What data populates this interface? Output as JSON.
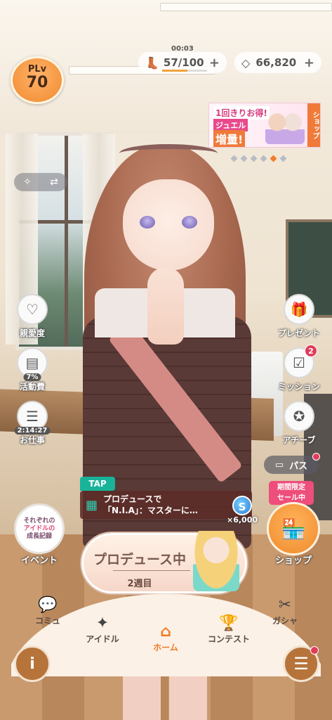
{
  "player": {
    "level_label": "PLv",
    "level": "70"
  },
  "stamina": {
    "timer": "00:03",
    "value": "57/100",
    "fill_fraction": 0.57
  },
  "jewels": {
    "value": "66,820"
  },
  "banner": {
    "line1": "1回きりお得!",
    "line2": "ジュエル",
    "line3": "増量!",
    "shop_tab": "ショップ",
    "dots_total": 6,
    "active_dot": 5
  },
  "side_left": [
    {
      "label": "親愛度"
    },
    {
      "label": "活動費",
      "sub": "7%"
    },
    {
      "label": "お仕事",
      "sub": "2:14:27"
    }
  ],
  "side_right": [
    {
      "label": "プレゼント"
    },
    {
      "label": "ミッション",
      "badge": "2"
    },
    {
      "label": "アチーブ"
    }
  ],
  "pass": {
    "label": "パス"
  },
  "sale_tag": {
    "line1": "期間限定",
    "line2": "セール中"
  },
  "shop": {
    "label": "ショップ"
  },
  "event": {
    "label": "イベント",
    "logo_line1": "それぞれの",
    "logo_line2": "アイドルの",
    "logo_line3": "成長記録"
  },
  "mission_ticker": {
    "tap_label": "TAP",
    "line1": "プロデュースで",
    "line2": "「N.I.A」：マスターに…",
    "reward_icon": "S",
    "reward_amount": "×6,000"
  },
  "produce": {
    "title": "プロデュース中",
    "week": "2週目"
  },
  "nav": [
    {
      "label": "コミュ",
      "icon": "chat-bubble-icon"
    },
    {
      "label": "アイドル",
      "icon": "idol-icon"
    },
    {
      "label": "ホーム",
      "icon": "home-icon",
      "active": true
    },
    {
      "label": "コンテスト",
      "icon": "trophy-icon"
    },
    {
      "label": "ガシャ",
      "icon": "gacha-icon"
    }
  ],
  "colors": {
    "accent": "#f07a2a",
    "badge": "#e23c5a",
    "tap": "#19b39a"
  }
}
